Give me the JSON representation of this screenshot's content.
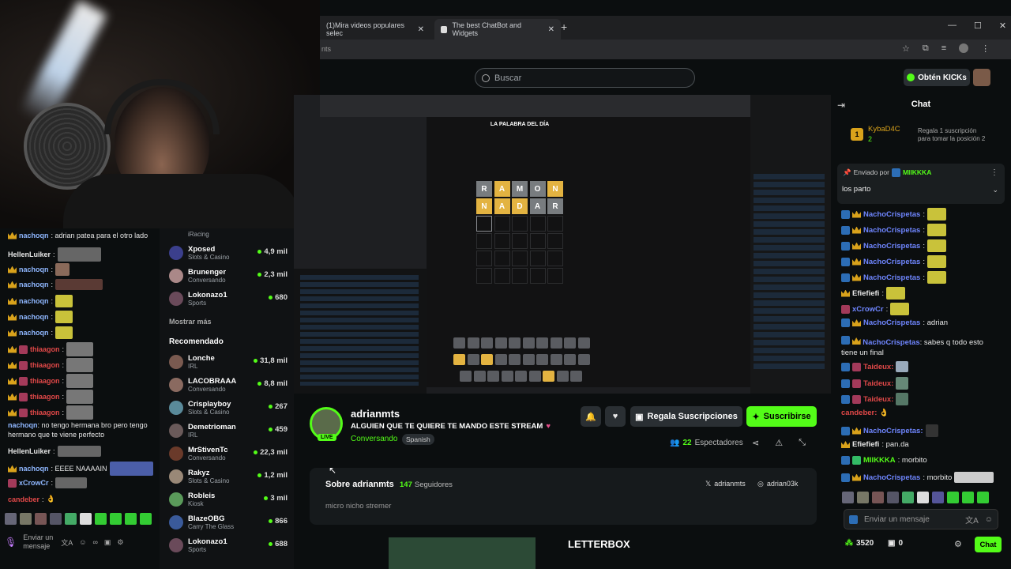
{
  "browser": {
    "tabs": [
      {
        "label": "(1)Mira videos populares selec"
      },
      {
        "label": "The best ChatBot and Widgets"
      }
    ],
    "address_fragment": "nts",
    "new_tab_symbol": "+"
  },
  "site": {
    "search_placeholder": "Buscar",
    "kicks_button": "Obtén KICKs"
  },
  "left_chat": {
    "messages": [
      {
        "user": "nachoqn",
        "text": ": adrian patea para el otro lado",
        "color": "blue",
        "badge": "crown"
      },
      {
        "user": "HellenLuiker",
        "text": ":",
        "color": "white",
        "badge": "none"
      },
      {
        "user": "nachoqn",
        "text": ":",
        "color": "blue",
        "badge": "crown"
      },
      {
        "user": "nachoqn",
        "text": ":",
        "color": "blue",
        "badge": "crown"
      },
      {
        "user": "nachoqn",
        "text": ":",
        "color": "blue",
        "badge": "crown"
      },
      {
        "user": "nachoqn",
        "text": ":",
        "color": "blue",
        "badge": "crown"
      },
      {
        "user": "nachoqn",
        "text": ":",
        "color": "blue",
        "badge": "crown"
      },
      {
        "user": "thiaagon",
        "text": ":",
        "color": "red",
        "badge": "crown"
      },
      {
        "user": "thiaagon",
        "text": ":",
        "color": "red",
        "badge": "crown"
      },
      {
        "user": "thiaagon",
        "text": ":",
        "color": "red",
        "badge": "crown"
      },
      {
        "user": "thiaagon",
        "text": ":",
        "color": "red",
        "badge": "crown"
      },
      {
        "user": "thiaagon",
        "text": ":",
        "color": "red",
        "badge": "crown"
      }
    ],
    "long_message": {
      "user": "nachoqn",
      "text": ": no tengo hermana bro pero tengo hermano que te viene perfecto"
    },
    "msg_hellen": {
      "user": "HellenLuiker",
      "text": ":"
    },
    "msg_eeee": {
      "user": "nachoqn",
      "text": ": EEEE NAAAAIN"
    },
    "msg_xcrow": {
      "user": "xCrowCr",
      "text": ":"
    },
    "msg_candeber": {
      "user": "candeber",
      "text": ":"
    },
    "input_placeholder": "Enviar un mensaje"
  },
  "sidebar": {
    "top_category": "iRacing",
    "channels": [
      {
        "name": "Xposed",
        "category": "Slots & Casino",
        "viewers": "4,9 mil"
      },
      {
        "name": "Brunenger",
        "category": "Conversando",
        "viewers": "2,3 mil"
      },
      {
        "name": "Lokonazo1",
        "category": "Sports",
        "viewers": "680"
      }
    ],
    "show_more": "Mostrar más",
    "recommended_title": "Recomendado",
    "recommended": [
      {
        "name": "Lonche",
        "category": "IRL",
        "viewers": "31,8 mil"
      },
      {
        "name": "LACOBRAAA",
        "category": "Conversando",
        "viewers": "8,8 mil"
      },
      {
        "name": "Crisplayboy",
        "category": "Slots & Casino",
        "viewers": "267"
      },
      {
        "name": "Demetrioman",
        "category": "IRL",
        "viewers": "459"
      },
      {
        "name": "MrStivenTc",
        "category": "Conversando",
        "viewers": "22,3 mil"
      },
      {
        "name": "Rakyz",
        "category": "Slots & Casino",
        "viewers": "1,2 mil"
      },
      {
        "name": "Robleis",
        "category": "Kiosk",
        "viewers": "3 mil"
      },
      {
        "name": "BlazeOBG",
        "category": "Carry The Glass",
        "viewers": "866"
      },
      {
        "name": "Lokonazo1",
        "category": "Sports",
        "viewers": "688"
      }
    ]
  },
  "game": {
    "title": "LA PALABRA DEL DÍA",
    "row1": [
      "R",
      "A",
      "M",
      "O",
      "N"
    ],
    "row1_colors": [
      "#787c7f",
      "#e3b341",
      "#787c7f",
      "#787c7f",
      "#e3b341"
    ],
    "row2": [
      "N",
      "A",
      "D",
      "A",
      "R"
    ],
    "row2_colors": [
      "#e3b341",
      "#e3b341",
      "#e3b341",
      "#787c7f",
      "#787c7f"
    ]
  },
  "stream_info": {
    "live_badge": "LIVE",
    "channel": "adrianmts",
    "title": "ALGUIEN QUE TE QUIERE TE MANDO ESTE STREAM",
    "heart": "♥",
    "category": "Conversando",
    "language": "Spanish",
    "gift_button": "Regala Suscripciones",
    "subscribe_button": "Suscribirse",
    "viewers_count": "22",
    "viewers_label": "Espectadores"
  },
  "about": {
    "title": "Sobre adrianmts",
    "followers_count": "147",
    "followers_label": "Seguidores",
    "bio": "micro nicho stremer",
    "x_handle": "adrianmts",
    "instagram_handle": "adrian03k",
    "panel_title": "LETTERBOX"
  },
  "right_chat": {
    "title": "Chat",
    "top_gifter": "KybaD4C",
    "top_gifter_count": "2",
    "gift_prompt_line1": "Regala 1 suscripción",
    "gift_prompt_line2": "para tomar la posición 2",
    "pinned_by_label": "Enviado por",
    "pinned_by_user": "MIIKKKA",
    "pinned_text": "los parto",
    "messages": [
      {
        "user": "NachoCrispetas",
        "text": ":"
      },
      {
        "user": "NachoCrispetas",
        "text": ":"
      },
      {
        "user": "NachoCrispetas",
        "text": ":"
      },
      {
        "user": "NachoCrispetas",
        "text": ":"
      },
      {
        "user": "NachoCrispetas",
        "text": ":"
      },
      {
        "user": "Efiefiefi",
        "text": ":"
      },
      {
        "user": "xCrowCr",
        "text": ":"
      },
      {
        "user": "NachoCrispetas",
        "text": ": adrian"
      }
    ],
    "msg_final_user": "NachoCrispetas",
    "msg_final_text": ": sabes q todo esto tiene un final",
    "msg_taideux": [
      "Taideux:",
      "Taideux:",
      "Taideux:"
    ],
    "msg_candeber": "candeber:",
    "msg_nacho2": "NachoCrispetas:",
    "msg_efie2_user": "Efiefiefi",
    "msg_efie2_text": ": pan.da",
    "msg_miik_user": "MIIKKKA",
    "msg_miik_text": ": morbito",
    "msg_nacho3_user": "NachoCrispetas",
    "msg_nacho3_text": ": morbito",
    "input_placeholder": "Enviar un mensaje",
    "points": "3520",
    "redeem_count": "0",
    "chat_button": "Chat"
  },
  "colors": {
    "kick_green": "#53fc18",
    "crown_gold": "#d9a21b",
    "username_blue": "#6f86ff"
  }
}
